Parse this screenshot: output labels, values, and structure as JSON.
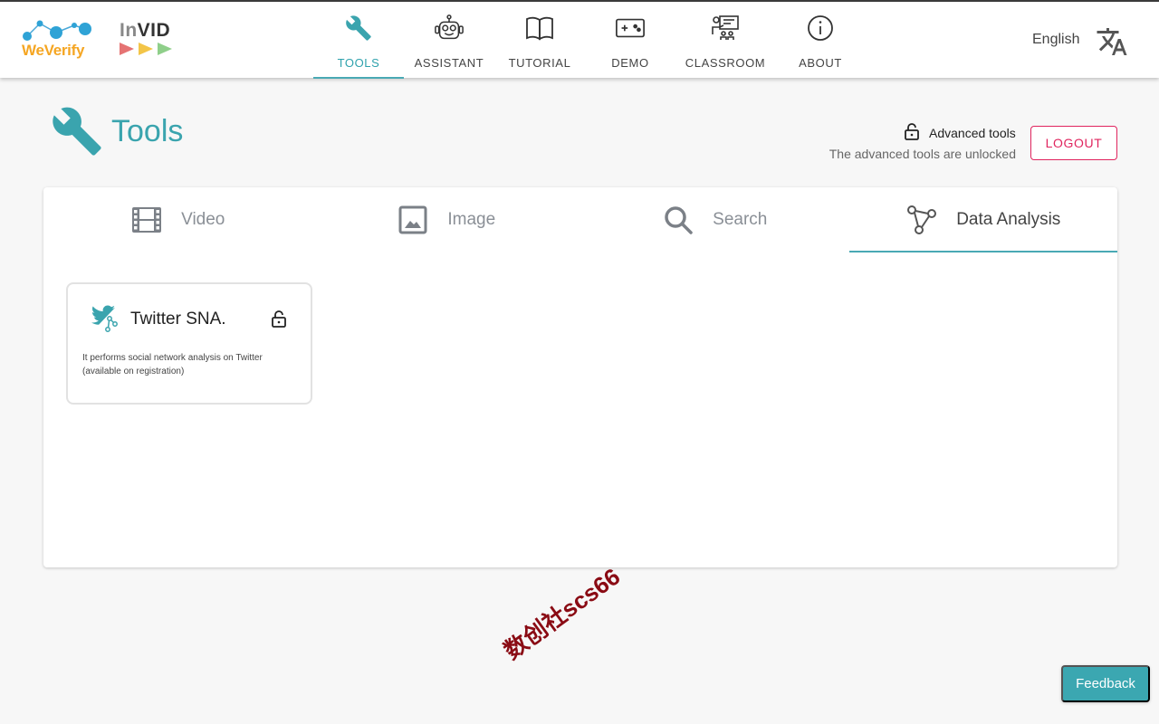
{
  "header": {
    "logos": {
      "weverify": "WeVerify",
      "invid_in": "In",
      "invid_vid": "VID"
    },
    "nav": [
      {
        "label": "TOOLS",
        "icon": "wrench-icon",
        "active": true
      },
      {
        "label": "ASSISTANT",
        "icon": "robot-icon",
        "active": false
      },
      {
        "label": "TUTORIAL",
        "icon": "book-icon",
        "active": false
      },
      {
        "label": "DEMO",
        "icon": "gamepad-icon",
        "active": false
      },
      {
        "label": "CLASSROOM",
        "icon": "classroom-icon",
        "active": false
      },
      {
        "label": "ABOUT",
        "icon": "info-icon",
        "active": false
      }
    ],
    "language": "English",
    "language_icon": "translate-icon"
  },
  "page": {
    "title": "Tools",
    "advanced_title": "Advanced tools",
    "advanced_status": "The advanced tools are unlocked",
    "logout_label": "LOGOUT"
  },
  "tabs": [
    {
      "label": "Video",
      "icon": "film-icon",
      "active": false
    },
    {
      "label": "Image",
      "icon": "image-icon",
      "active": false
    },
    {
      "label": "Search",
      "icon": "search-icon",
      "active": false
    },
    {
      "label": "Data Analysis",
      "icon": "graph-nodes-icon",
      "active": true
    }
  ],
  "tools": [
    {
      "name": "Twitter SNA.",
      "description": "It performs social network analysis on Twitter (available on registration)",
      "icon": "twitter-sna-icon",
      "locked_icon": "lock-open-icon"
    }
  ],
  "watermark": "数创社scs66",
  "feedback_label": "Feedback",
  "colors": {
    "accent": "#3aa4ae",
    "logout": "#e0245e",
    "feedback": "#3ba7b1"
  }
}
